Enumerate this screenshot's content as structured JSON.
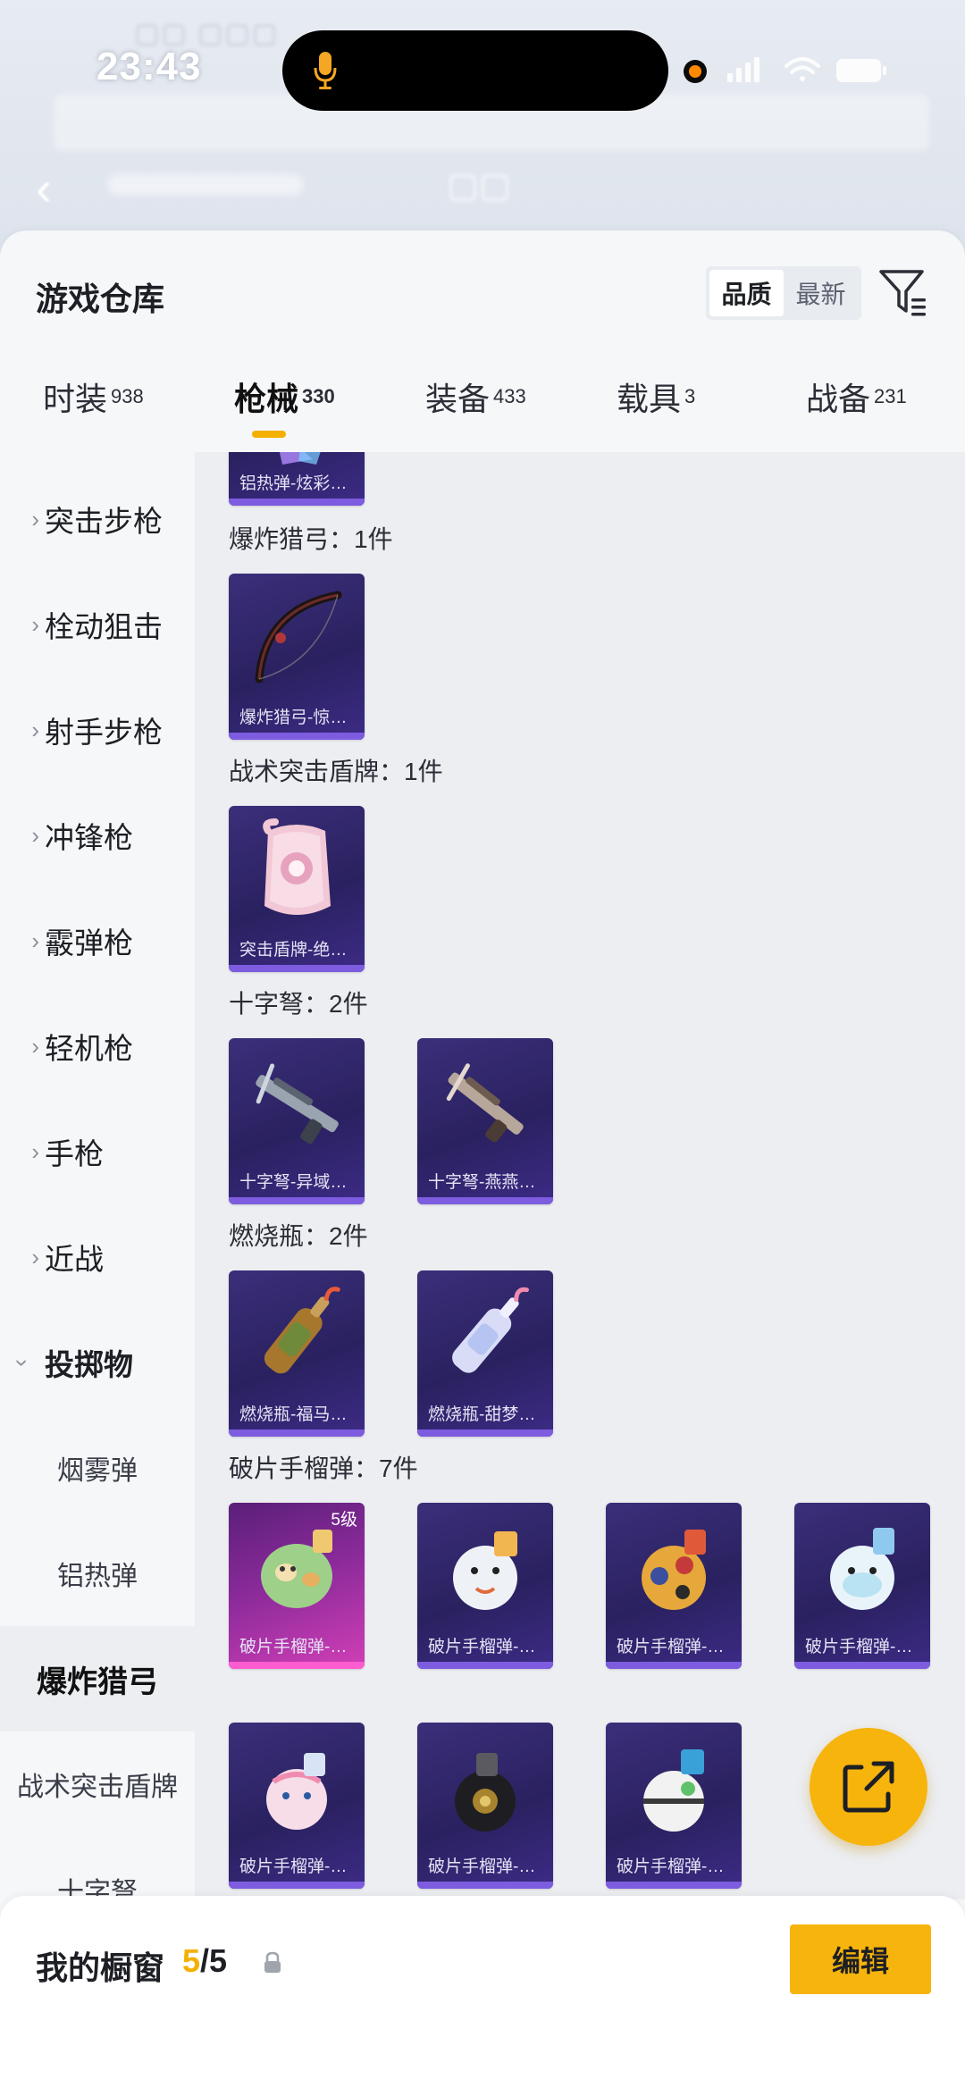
{
  "status_bar": {
    "time": "23:43"
  },
  "sheet": {
    "title": "游戏仓库",
    "sort_options": [
      "品质",
      "最新"
    ],
    "active_sort": "品质"
  },
  "tabs": [
    {
      "label": "时装",
      "count": "938"
    },
    {
      "label": "枪械",
      "count": "330",
      "active": true
    },
    {
      "label": "装备",
      "count": "433"
    },
    {
      "label": "载具",
      "count": "3"
    },
    {
      "label": "战备",
      "count": "231"
    }
  ],
  "left_nav": {
    "categories": [
      "突击步枪",
      "栓动狙击",
      "射手步枪",
      "冲锋枪",
      "霰弹枪",
      "轻机枪",
      "手枪",
      "近战",
      "投掷物"
    ],
    "subcategories": [
      "烟雾弹",
      "铝热弹",
      "爆炸猎弓",
      "战术突击盾牌",
      "十字弩"
    ],
    "active_sub": "爆炸猎弓"
  },
  "content": {
    "partial_card_caption": "铝热弹-炫彩…",
    "groups": [
      {
        "title": "爆炸猎弓：1件",
        "items": [
          "爆炸猎弓-惊…"
        ]
      },
      {
        "title": "战术突击盾牌：1件",
        "items": [
          "突击盾牌-绝…"
        ]
      },
      {
        "title": "十字弩：2件",
        "items": [
          "十字弩-异域…",
          "十字弩-燕燕…"
        ]
      },
      {
        "title": "燃烧瓶：2件",
        "items": [
          "燃烧瓶-福马…",
          "燃烧瓶-甜梦…"
        ]
      },
      {
        "title": "破片手榴弹：7件",
        "items": [
          "破片手榴弹-…",
          "破片手榴弹-…",
          "破片手榴弹-…",
          "破片手榴弹-…",
          "破片手榴弹-…",
          "破片手榴弹-…",
          "破片手榴弹-…"
        ]
      }
    ],
    "level_badge": "5级"
  },
  "bottom_bar": {
    "label": "我的橱窗",
    "current": "5",
    "total": "/5",
    "edit_label": "编辑"
  },
  "colors": {
    "accent": "#f6b40c",
    "card_purple": "#2a2160",
    "card_pink": "#d23fb6"
  }
}
